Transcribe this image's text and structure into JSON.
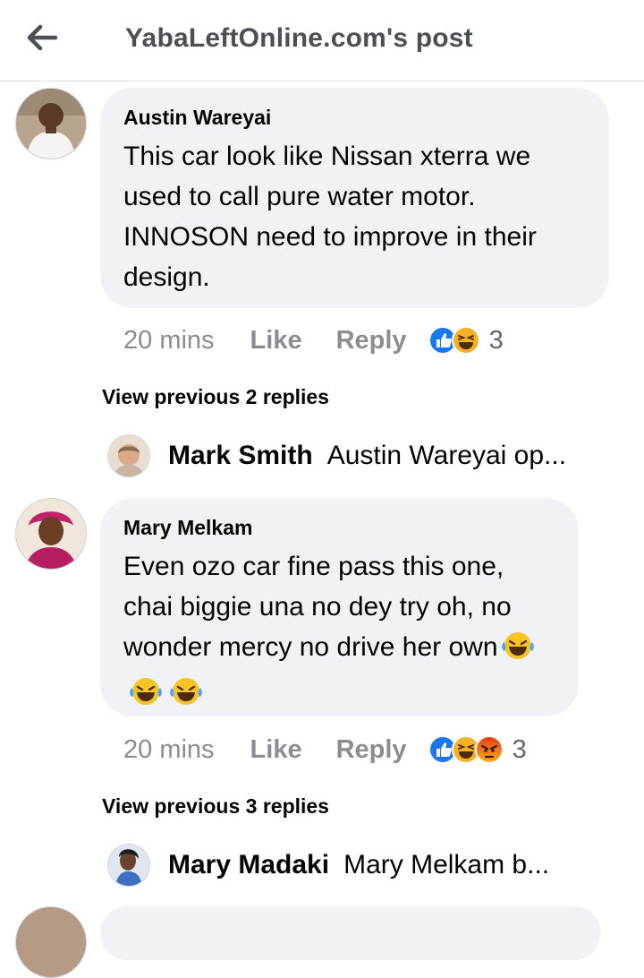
{
  "header": {
    "title": "YabaLeftOnline.com's post",
    "back_icon": "arrow-left-icon"
  },
  "comments": [
    {
      "author": "Austin Wareyai",
      "text": "This car look like Nissan xterra we used to call pure water motor. INNOSON need to improve in their design.",
      "time": "20 mins",
      "like_label": "Like",
      "reply_label": "Reply",
      "reactions": [
        "like",
        "haha"
      ],
      "reaction_count": "3",
      "view_replies": "View previous 2 replies",
      "latest_reply": {
        "author": "Mark Smith",
        "text": "Austin Wareyai op..."
      }
    },
    {
      "author": "Mary Melkam",
      "text": "Even ozo car fine pass this one, chai biggie una no dey try oh, no wonder mercy no drive her own",
      "text_emojis": [
        "rofl",
        "rofl",
        "rofl"
      ],
      "time": "20 mins",
      "like_label": "Like",
      "reply_label": "Reply",
      "reactions": [
        "like",
        "haha",
        "angry"
      ],
      "reaction_count": "3",
      "view_replies": "View previous 3 replies",
      "latest_reply": {
        "author": "Mary Madaki",
        "text": "Mary Melkam b..."
      }
    }
  ],
  "colors": {
    "bubble": "#f0f2f5",
    "like_blue": "#1877f2",
    "haha_yellow": "#f7b125",
    "angry_orange": "#e9710f",
    "meta_gray": "#8a8d91"
  }
}
